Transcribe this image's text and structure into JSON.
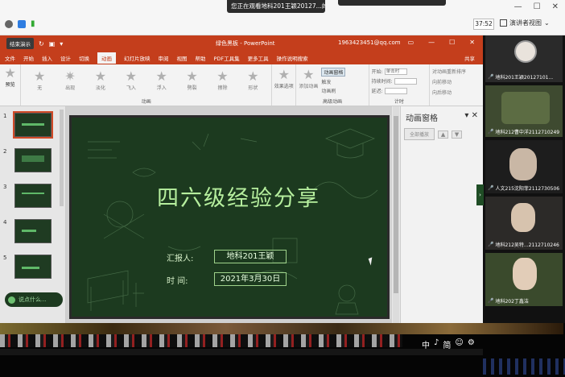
{
  "meeting": {
    "share_banner": "您正在观看地科201王颖20127...的屏幕",
    "timer": "37:52",
    "presenter_view": "演讲者视图"
  },
  "ppt": {
    "stop_share": "结束演示",
    "doc_title": "绿色黑板 - PowerPoint",
    "account": "1963423451@qq.com",
    "tabs": [
      "文件",
      "开始",
      "插入",
      "设计",
      "切换",
      "动画",
      "幻灯片放映",
      "审阅",
      "视图",
      "帮助",
      "PDF工具集",
      "更多工具",
      "操作说明搜索"
    ],
    "active_tab": "动画",
    "share": "共享",
    "preview": "预览",
    "animations": [
      "无",
      "出现",
      "淡化",
      "飞入",
      "浮入",
      "劈裂",
      "擦除",
      "形状"
    ],
    "effect_options": "效果选项",
    "add_animation": "添加动画",
    "anim_pane_btn": "动画窗格",
    "trigger": "触发",
    "anim_painter": "动画刷",
    "group_anim": "动画",
    "group_adv": "高级动画",
    "group_timing": "计时",
    "start_label": "开始:",
    "start_value": "单击时",
    "duration_label": "持续时间:",
    "delay_label": "延迟:",
    "reorder_title": "对动画重新排序",
    "move_earlier": "向前移动",
    "move_later": "向后移动"
  },
  "slides": {
    "numbers": [
      "1",
      "2",
      "3",
      "4",
      "5"
    ],
    "toast": "说点什么..."
  },
  "slide": {
    "title": "四六级经验分享",
    "reporter_label": "汇报人:",
    "reporter_value": "地科201王颖",
    "time_label": "时 间:",
    "time_value": "2021年3月30日"
  },
  "anim_pane": {
    "title": "动画窗格",
    "play_all": "全部播放"
  },
  "participants": [
    {
      "name": "地科201王颖20127101..."
    },
    {
      "name": "地科212曹中洋2112710249"
    },
    {
      "name": "人文215沈阳菲2112730506"
    },
    {
      "name": "地科212吴特...2112710246"
    },
    {
      "name": "地科202丁鑫洁"
    }
  ],
  "ime": [
    "中",
    "♪",
    "简",
    "☺",
    "⚙"
  ]
}
